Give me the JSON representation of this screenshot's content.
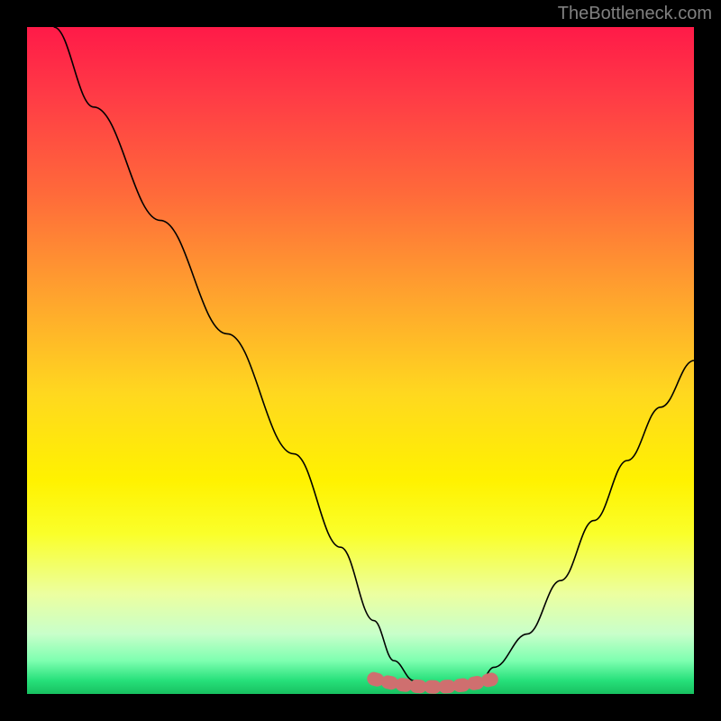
{
  "attribution": "TheBottleneck.com",
  "chart_data": {
    "type": "line",
    "title": "",
    "xlabel": "",
    "ylabel": "",
    "ylim": [
      0,
      100
    ],
    "xlim": [
      0,
      100
    ],
    "series": [
      {
        "name": "bottleneck-curve",
        "x": [
          4,
          10,
          20,
          30,
          40,
          47,
          52,
          55,
          58,
          60,
          65,
          68,
          70,
          75,
          80,
          85,
          90,
          95,
          100
        ],
        "values": [
          100,
          88,
          71,
          54,
          36,
          22,
          11,
          5,
          2,
          1,
          1,
          2,
          4,
          9,
          17,
          26,
          35,
          43,
          50
        ]
      }
    ],
    "flat_region": {
      "start_x": 52,
      "end_x": 70,
      "value": 2,
      "color": "#cf6f6f"
    },
    "gradient_stops": [
      {
        "pos": 0,
        "color": "#ff1a48"
      },
      {
        "pos": 25,
        "color": "#ff6a3a"
      },
      {
        "pos": 55,
        "color": "#ffd81f"
      },
      {
        "pos": 85,
        "color": "#ecffa0"
      },
      {
        "pos": 100,
        "color": "#18c060"
      }
    ]
  }
}
